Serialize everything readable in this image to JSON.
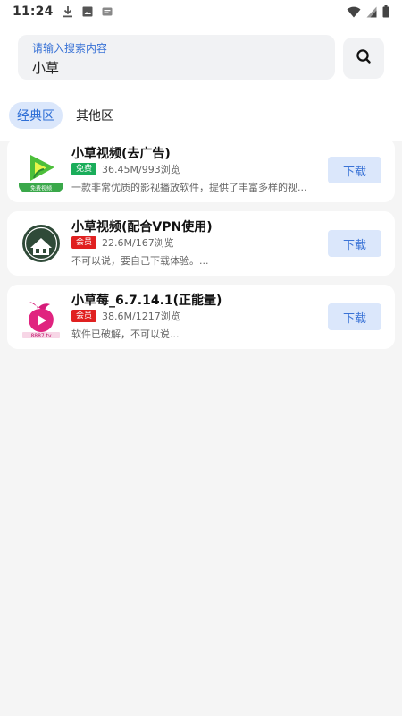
{
  "status_bar": {
    "time": "11:24",
    "left_icons": [
      "download-icon",
      "image-icon",
      "message-icon"
    ],
    "right_icons": [
      "wifi-icon",
      "signal-icon",
      "battery-icon"
    ]
  },
  "search": {
    "placeholder": "请输入搜索内容",
    "value": "小草",
    "button_icon": "search-icon"
  },
  "tabs": [
    {
      "label": "经典区",
      "active": true
    },
    {
      "label": "其他区",
      "active": false
    }
  ],
  "apps": [
    {
      "title": "小草视频(去广告)",
      "badge": "免费",
      "badge_color": "#1aad5a",
      "meta": "36.45M/993浏览",
      "description": "一款非常优质的影视播放软件，提供了丰富多样的视...",
      "download_label": "下载",
      "icon": "grass-video-logo",
      "icon_caption": "免费视频"
    },
    {
      "title": "小草视频(配合VPN使用)",
      "badge": "会员",
      "badge_color": "#e02020",
      "meta": "22.6M/167浏览",
      "description": "不可以说，要自己下载体验。...",
      "download_label": "下载",
      "icon": "house-logo"
    },
    {
      "title": "小草莓_6.7.14.1(正能量)",
      "badge": "会员",
      "badge_color": "#e02020",
      "meta": "38.6M/1217浏览",
      "description": "软件已破解，不可以说...",
      "download_label": "下载",
      "icon": "strawberry-logo",
      "icon_caption": "8887.tv"
    }
  ],
  "colors": {
    "accent": "#3a73d6",
    "tab_active_bg": "#dbe7fb",
    "badge_free": "#1aad5a",
    "badge_vip": "#e02020"
  }
}
